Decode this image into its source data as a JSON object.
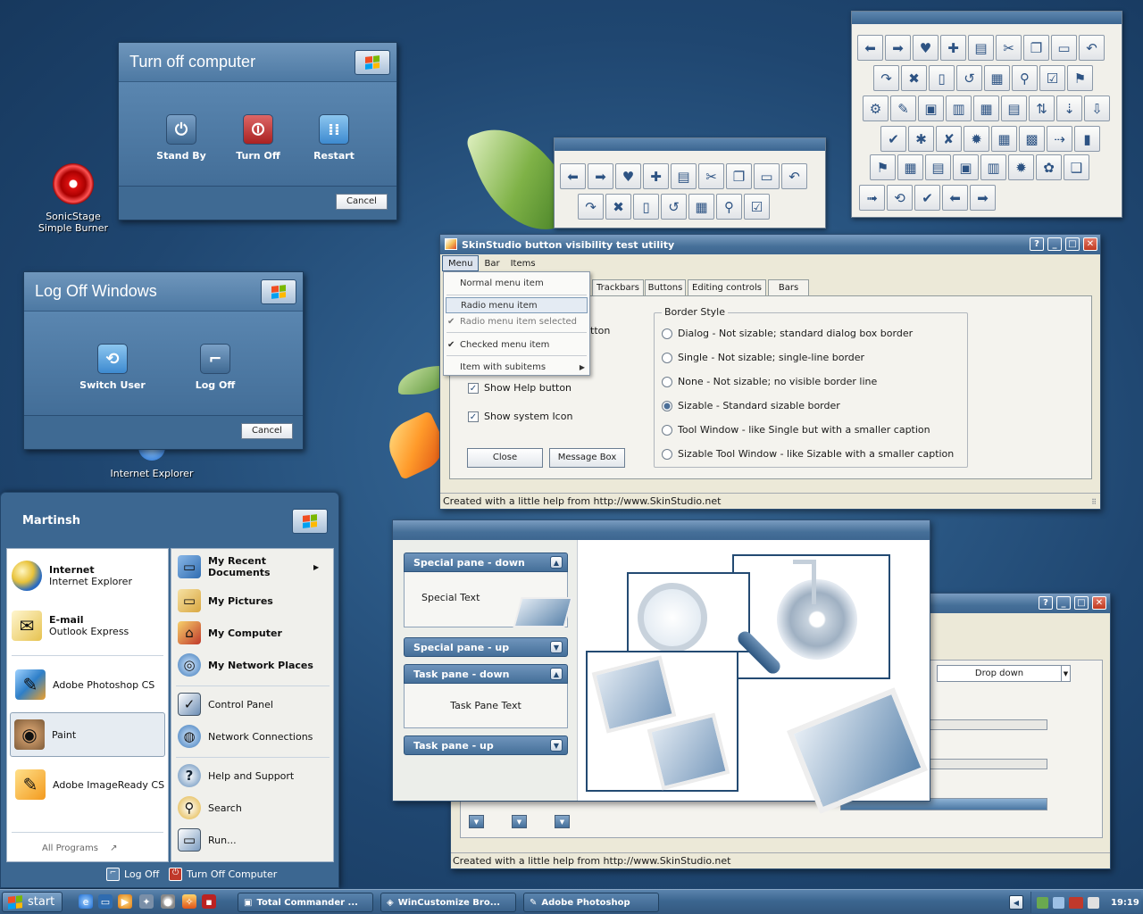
{
  "desktop_icons": [
    {
      "label": "SonicStage Simple Burner"
    },
    {
      "label": "Internet Explorer"
    }
  ],
  "turn_off": {
    "title": "Turn off computer",
    "buttons": [
      "Stand By",
      "Turn Off",
      "Restart"
    ],
    "cancel": "Cancel"
  },
  "log_off": {
    "title": "Log Off Windows",
    "buttons": [
      "Switch User",
      "Log Off"
    ],
    "cancel": "Cancel"
  },
  "skin": {
    "title": "SkinStudio button visibility test utility",
    "menubar": [
      "Menu",
      "Bar",
      "Items"
    ],
    "menu_items": [
      "Normal menu item",
      "Radio menu item",
      "Radio menu item selected",
      "Checked menu item",
      "Item with subitems"
    ],
    "tabs": [
      "Trackbars",
      "Buttons",
      "Editing controls",
      "Bars"
    ],
    "partial_label": "tton",
    "checks": [
      "Show Help button",
      "Show system Icon"
    ],
    "close_btn": "Close",
    "message_btn": "Message Box",
    "border_title": "Border Style",
    "border_options": [
      "Dialog - Not sizable; standard dialog box border",
      "Single - Not sizable; single-line border",
      "None - Not sizable; no visible border line",
      "Sizable - Standard sizable border",
      "Tool Window - like Single but with a smaller caption",
      "Sizable Tool Window - like Sizable with a smaller caption"
    ],
    "selected_option": 3,
    "status": "Created with a little help from http://www.SkinStudio.net"
  },
  "taskpane": {
    "panes": [
      {
        "title": "Special pane - down",
        "text": "Special Text"
      },
      {
        "title": "Special pane - up"
      },
      {
        "title": "Task pane - down",
        "text": "Task Pane Text"
      },
      {
        "title": "Task pane - up"
      }
    ]
  },
  "back_window": {
    "dropdown": "Drop down",
    "status": "Created with a little help from http://www.SkinStudio.net"
  },
  "start_menu": {
    "user": "Martinsh",
    "pinned": [
      {
        "title": "Internet",
        "sub": "Internet Explorer"
      },
      {
        "title": "E-mail",
        "sub": "Outlook Express"
      }
    ],
    "recent": [
      "Adobe Photoshop CS",
      "Paint",
      "Adobe ImageReady CS"
    ],
    "all_programs": "All Programs",
    "right": [
      "My Recent Documents",
      "My Pictures",
      "My Computer",
      "My Network Places",
      "Control Panel",
      "Network Connections",
      "Help and Support",
      "Search",
      "Run..."
    ],
    "log_off": "Log Off",
    "turn_off": "Turn Off Computer"
  },
  "taskbar": {
    "start": "start",
    "tasks": [
      "Total Commander ...",
      "WinCustomize Bro...",
      "Adobe Photoshop"
    ],
    "clock": "19:19"
  },
  "colors": {
    "accent": "#3c6791",
    "title": "#456f98",
    "desktop": "#2d5b88"
  }
}
